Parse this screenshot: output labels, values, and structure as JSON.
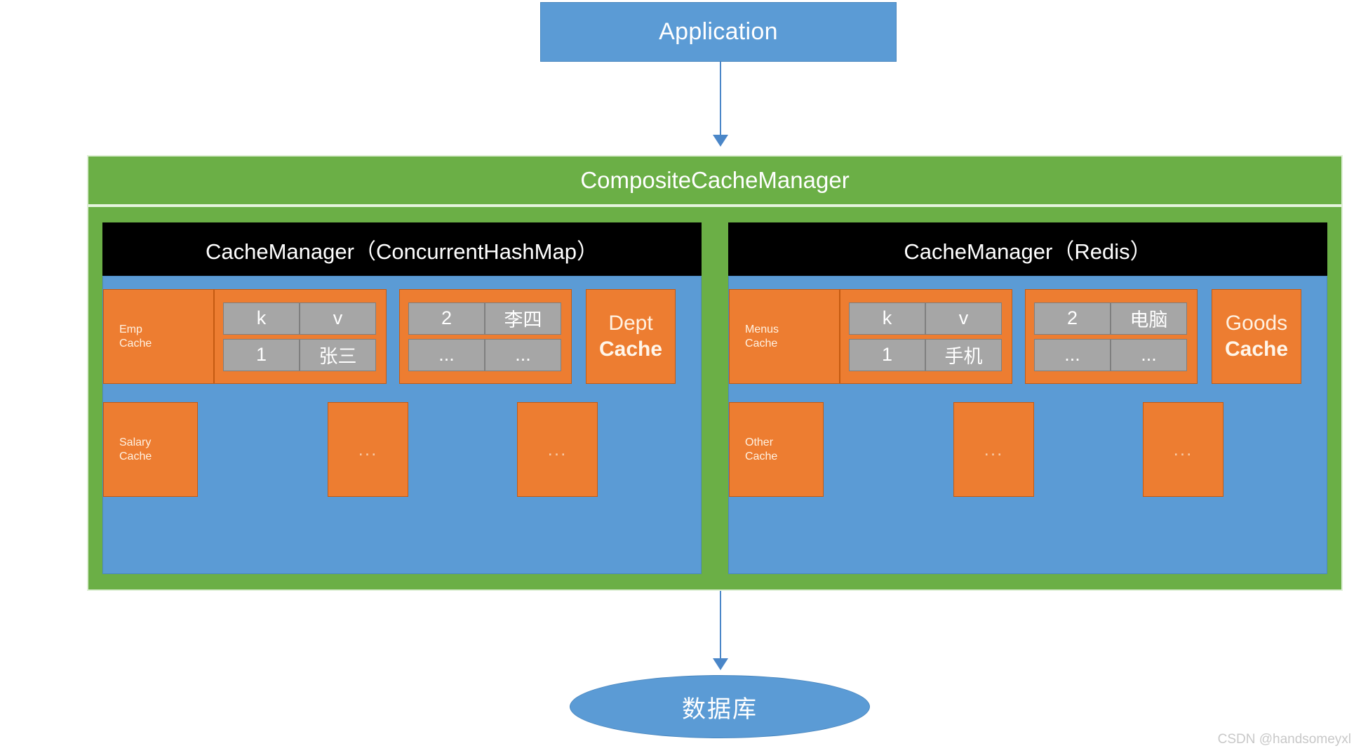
{
  "diagram": {
    "application": {
      "label": "Application"
    },
    "composite": {
      "title": "CompositeCacheManager"
    },
    "database": {
      "label": "数据库"
    },
    "watermark": "CSDN @handsomeyxl",
    "colors": {
      "blue": "#5B9BD5",
      "green": "#6BAF46",
      "orange": "#ED7D31",
      "gray": "#A6A6A6",
      "black": "#000000"
    },
    "panels": [
      {
        "header": "CacheManager（ConcurrentHashMap）",
        "row1": {
          "cache_name": "Emp",
          "cache_sub": "Cache",
          "table_left": {
            "header": [
              "k",
              "v"
            ],
            "row": [
              "1",
              "张三"
            ]
          },
          "table_right": {
            "header": [
              "2",
              "李四"
            ],
            "row": [
              "...",
              "..."
            ]
          },
          "tail_cache_name": "Dept",
          "tail_cache_sub": "Cache"
        },
        "row2": {
          "cache_name": "Salary",
          "cache_sub": "Cache",
          "middle_box": "...",
          "tail_box": "..."
        }
      },
      {
        "header": "CacheManager（Redis）",
        "row1": {
          "cache_name": "Menus",
          "cache_sub": "Cache",
          "table_left": {
            "header": [
              "k",
              "v"
            ],
            "row": [
              "1",
              "手机"
            ]
          },
          "table_right": {
            "header": [
              "2",
              "电脑"
            ],
            "row": [
              "...",
              "..."
            ]
          },
          "tail_cache_name": "Goods",
          "tail_cache_sub": "Cache"
        },
        "row2": {
          "cache_name": "Other",
          "cache_sub": "Cache",
          "middle_box": "...",
          "tail_box": "..."
        }
      }
    ]
  }
}
